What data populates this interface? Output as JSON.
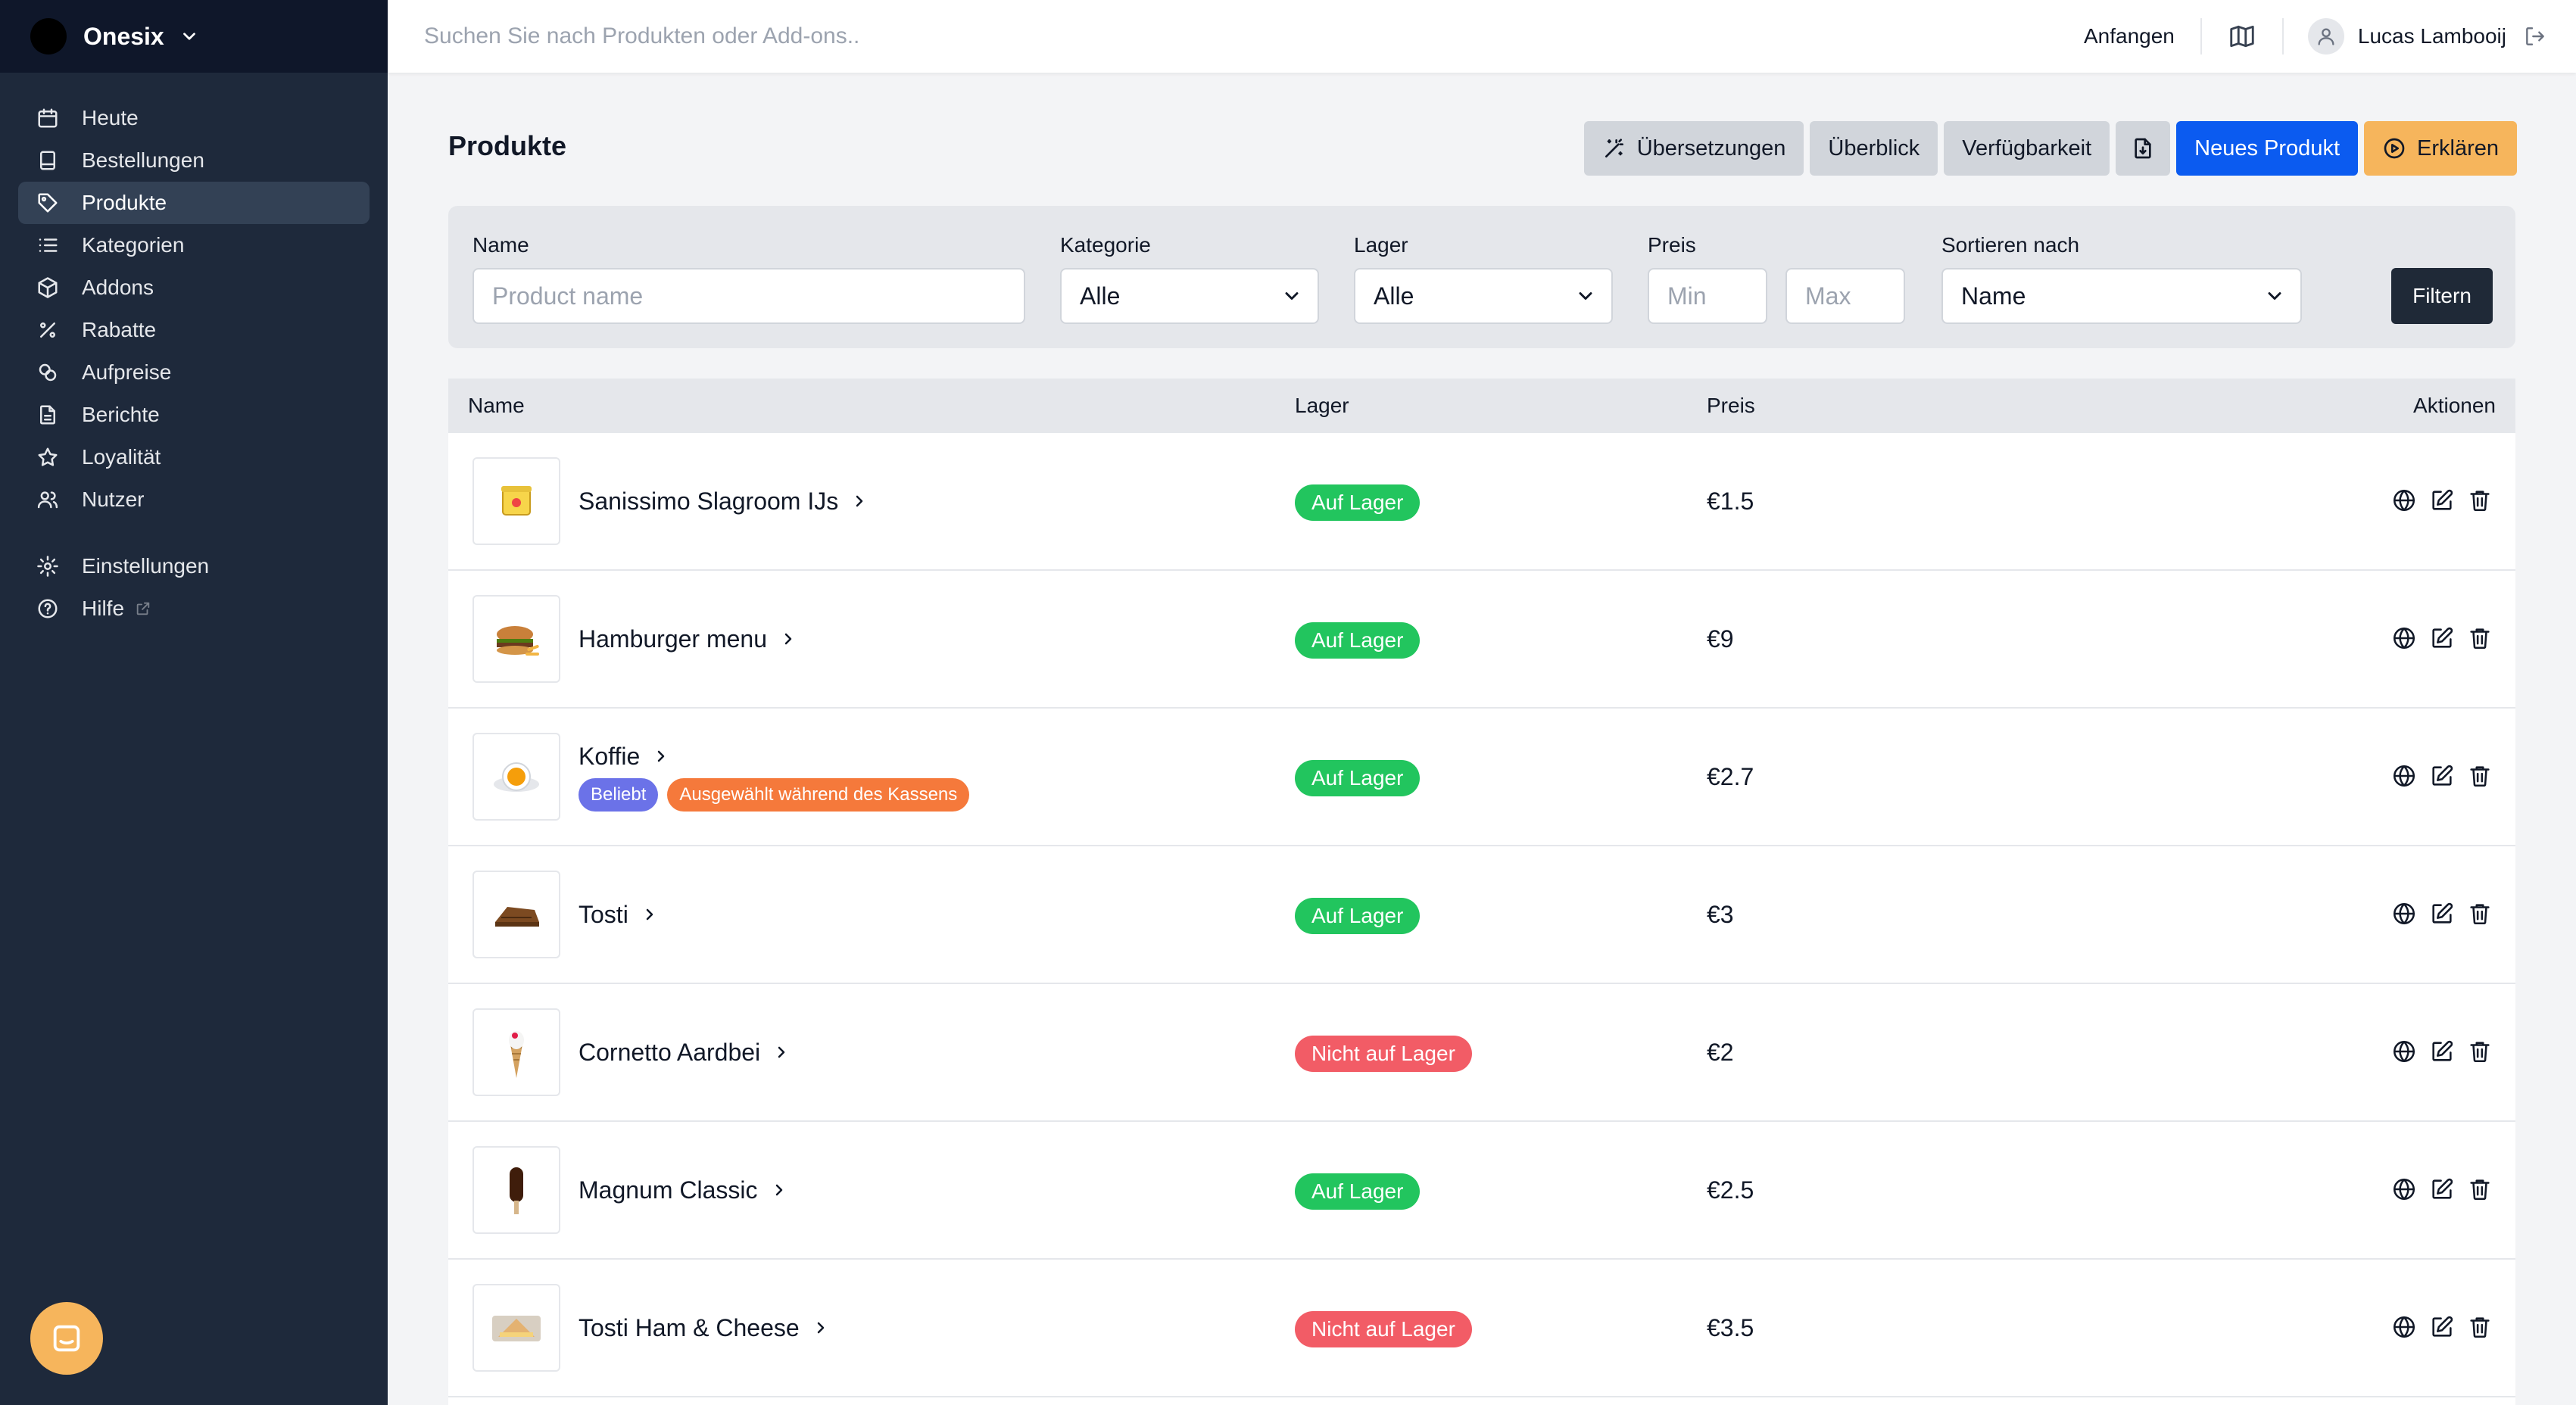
{
  "brand": {
    "name": "Onesix"
  },
  "sidebar": {
    "items": [
      {
        "label": "Heute",
        "icon": "calendar-icon",
        "active": false
      },
      {
        "label": "Bestellungen",
        "icon": "receipt-icon",
        "active": false
      },
      {
        "label": "Produkte",
        "icon": "tag-icon",
        "active": true
      },
      {
        "label": "Kategorien",
        "icon": "list-icon",
        "active": false
      },
      {
        "label": "Addons",
        "icon": "cube-icon",
        "active": false
      },
      {
        "label": "Rabatte",
        "icon": "percent-icon",
        "active": false
      },
      {
        "label": "Aufpreise",
        "icon": "receipt-percent-icon",
        "active": false
      },
      {
        "label": "Berichte",
        "icon": "document-icon",
        "active": false
      },
      {
        "label": "Loyalität",
        "icon": "star-icon",
        "active": false
      },
      {
        "label": "Nutzer",
        "icon": "users-icon",
        "active": false
      }
    ],
    "secondary": [
      {
        "label": "Einstellungen",
        "icon": "gear-icon"
      },
      {
        "label": "Hilfe",
        "icon": "help-icon"
      }
    ]
  },
  "topbar": {
    "search_placeholder": "Suchen Sie nach Produkten oder Add-ons..",
    "start_label": "Anfangen",
    "user_name": "Lucas Lambooij"
  },
  "header": {
    "title": "Produkte",
    "buttons": {
      "translations": "Übersetzungen",
      "overview": "Überblick",
      "availability": "Verfügbarkeit",
      "new_product": "Neues Produkt",
      "explain": "Erklären"
    }
  },
  "filters": {
    "name_label": "Name",
    "name_placeholder": "Product name",
    "category_label": "Kategorie",
    "category_value": "Alle",
    "stock_label": "Lager",
    "stock_value": "Alle",
    "price_label": "Preis",
    "price_min_placeholder": "Min",
    "price_max_placeholder": "Max",
    "sort_label": "Sortieren nach",
    "sort_value": "Name",
    "filter_button": "Filtern"
  },
  "table": {
    "columns": {
      "name": "Name",
      "stock": "Lager",
      "price": "Preis",
      "actions": "Aktionen"
    },
    "rows": [
      {
        "name": "Sanissimo Slagroom IJs",
        "stock": "Auf Lager",
        "in_stock": true,
        "price": "€1.5",
        "tags": [],
        "image": "ice-cream-tub"
      },
      {
        "name": "Hamburger menu",
        "stock": "Auf Lager",
        "in_stock": true,
        "price": "€9",
        "tags": [],
        "image": "hamburger"
      },
      {
        "name": "Koffie",
        "stock": "Auf Lager",
        "in_stock": true,
        "price": "€2.7",
        "tags": [
          {
            "label": "Beliebt",
            "color": "#6b72e8"
          },
          {
            "label": "Ausgewählt während des Kassens",
            "color": "#f5793b"
          }
        ],
        "image": "coffee"
      },
      {
        "name": "Tosti",
        "stock": "Auf Lager",
        "in_stock": true,
        "price": "€3",
        "tags": [],
        "image": "tosti"
      },
      {
        "name": "Cornetto Aardbei",
        "stock": "Nicht auf Lager",
        "in_stock": false,
        "price": "€2",
        "tags": [],
        "image": "cornetto"
      },
      {
        "name": "Magnum Classic",
        "stock": "Auf Lager",
        "in_stock": true,
        "price": "€2.5",
        "tags": [],
        "image": "magnum"
      },
      {
        "name": "Tosti Ham & Cheese",
        "stock": "Nicht auf Lager",
        "in_stock": false,
        "price": "€3.5",
        "tags": [],
        "image": "sandwich"
      }
    ]
  },
  "colors": {
    "sidebar_bg": "#1e293b",
    "brand_bg": "#0f172a",
    "primary": "#0b5bf0",
    "warning": "#f6b55c",
    "in_stock": "#22c55e",
    "out_of_stock": "#f25c66"
  }
}
